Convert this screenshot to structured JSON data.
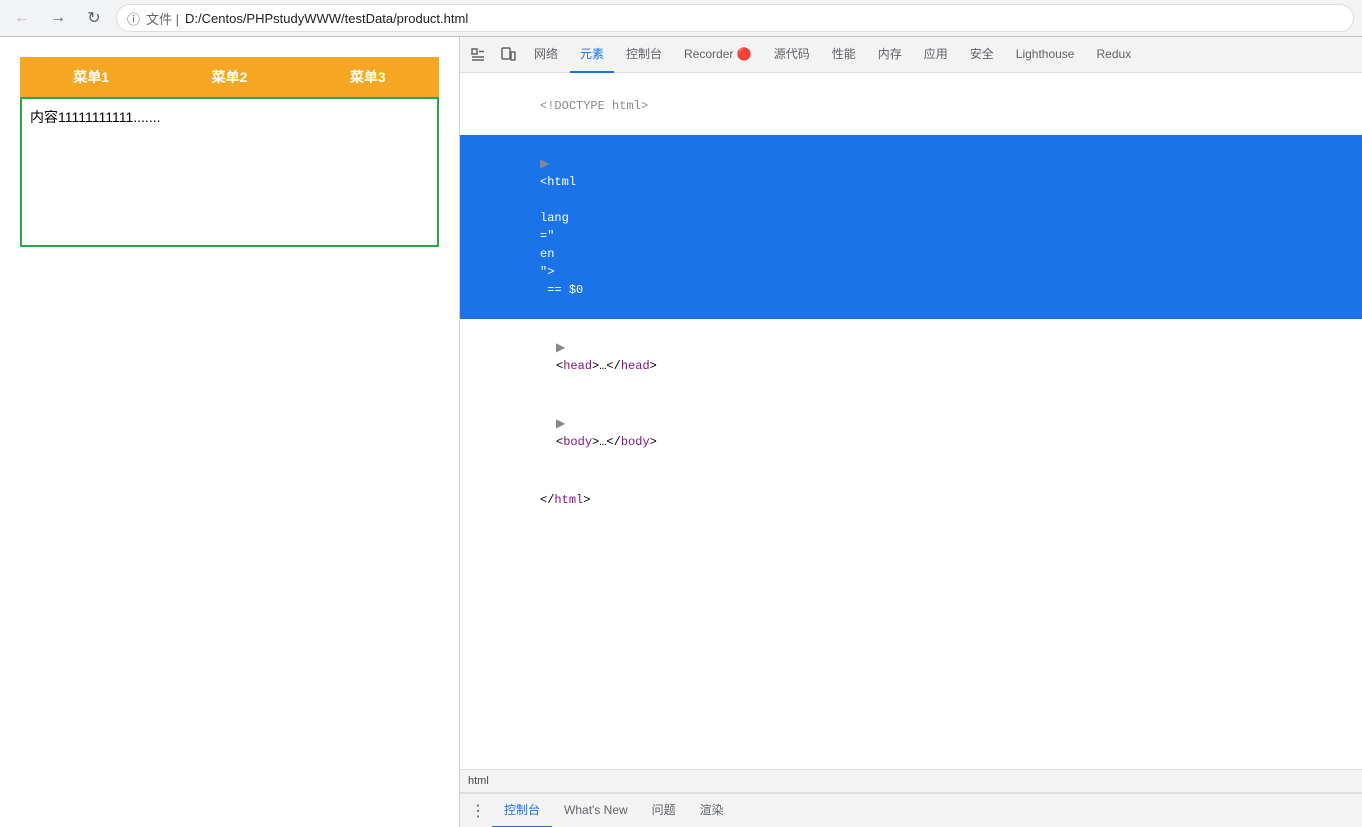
{
  "browser": {
    "toolbar": {
      "back_label": "←",
      "forward_label": "→",
      "reload_label": "↻",
      "info_label": "ℹ",
      "address_prefix": "文件 | ",
      "address_url": "D:/Centos/PHPstudyWWW/testData/product.html"
    }
  },
  "webpage": {
    "menu_items": [
      "菜单1",
      "菜单2",
      "菜单3"
    ],
    "content_text": "内容11111111111......."
  },
  "devtools": {
    "tabs": [
      {
        "label": "🔲",
        "icon": true
      },
      {
        "label": "📱",
        "icon": true
      },
      {
        "label": "网络"
      },
      {
        "label": "元素",
        "active": true
      },
      {
        "label": "控制台"
      },
      {
        "label": "Recorder 🔴"
      },
      {
        "label": "源代码"
      },
      {
        "label": "性能"
      },
      {
        "label": "内存"
      },
      {
        "label": "应用"
      },
      {
        "label": "安全"
      },
      {
        "label": "Lighthouse"
      },
      {
        "label": "Redux"
      }
    ],
    "elements": {
      "doctype_comment": "<!DOCTYPE html>",
      "html_tag": "<html lang=\"en\">",
      "html_selected_suffix": " == $0",
      "head_tag": "<head>…</head>",
      "body_tag": "<body>…</body>",
      "html_close": "</html>"
    },
    "status_bar_text": "html",
    "bottom_tabs": [
      {
        "label": "⋮",
        "menu": true
      },
      {
        "label": "控制台",
        "active": true
      },
      {
        "label": "What's New"
      },
      {
        "label": "问题"
      },
      {
        "label": "渲染"
      }
    ]
  }
}
